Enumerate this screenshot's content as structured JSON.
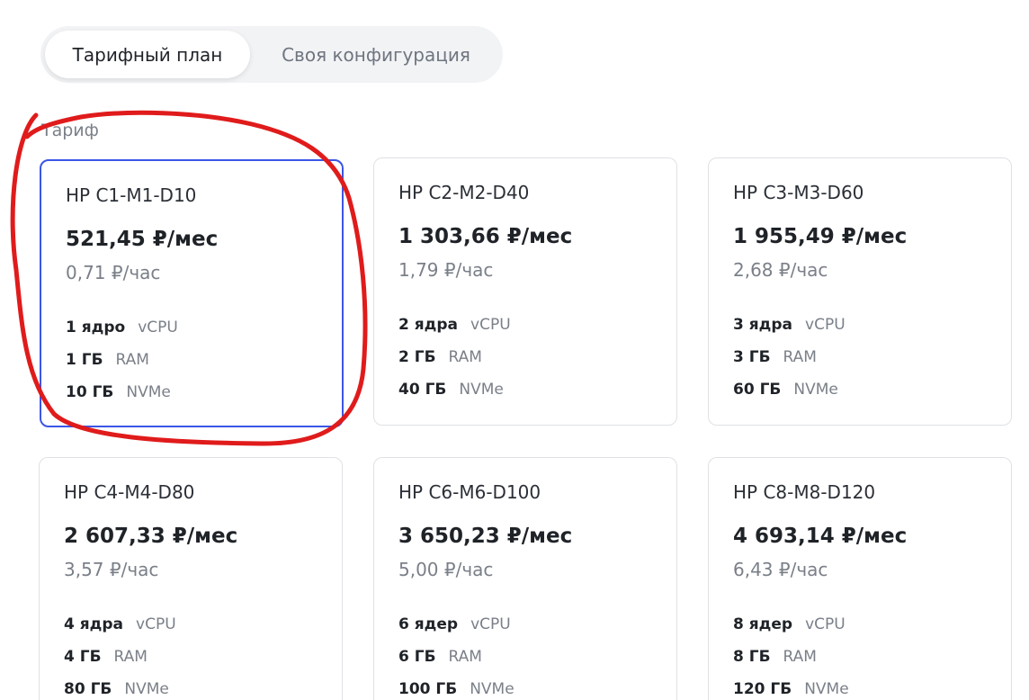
{
  "tabs": [
    {
      "label": "Тарифный план",
      "active": true
    },
    {
      "label": "Своя конфигурация",
      "active": false
    }
  ],
  "section_label": "Тариф",
  "colors": {
    "selected_border": "#3b56e6",
    "annotation": "#e01b1b"
  },
  "plans": [
    {
      "name": "HP C1-M1-D10",
      "price_month": "521,45 ₽/мес",
      "price_hour": "0,71 ₽/час",
      "cpu_value": "1 ядро",
      "cpu_unit": "vCPU",
      "ram_value": "1 ГБ",
      "ram_unit": "RAM",
      "disk_value": "10 ГБ",
      "disk_unit": "NVMe",
      "selected": true
    },
    {
      "name": "HP C2-M2-D40",
      "price_month": "1 303,66 ₽/мес",
      "price_hour": "1,79 ₽/час",
      "cpu_value": "2 ядра",
      "cpu_unit": "vCPU",
      "ram_value": "2 ГБ",
      "ram_unit": "RAM",
      "disk_value": "40 ГБ",
      "disk_unit": "NVMe",
      "selected": false
    },
    {
      "name": "HP C3-M3-D60",
      "price_month": "1 955,49 ₽/мес",
      "price_hour": "2,68 ₽/час",
      "cpu_value": "3 ядра",
      "cpu_unit": "vCPU",
      "ram_value": "3 ГБ",
      "ram_unit": "RAM",
      "disk_value": "60 ГБ",
      "disk_unit": "NVMe",
      "selected": false
    },
    {
      "name": "HP C4-M4-D80",
      "price_month": "2 607,33 ₽/мес",
      "price_hour": "3,57 ₽/час",
      "cpu_value": "4 ядра",
      "cpu_unit": "vCPU",
      "ram_value": "4 ГБ",
      "ram_unit": "RAM",
      "disk_value": "80 ГБ",
      "disk_unit": "NVMe",
      "selected": false
    },
    {
      "name": "HP C6-M6-D100",
      "price_month": "3 650,23 ₽/мес",
      "price_hour": "5,00 ₽/час",
      "cpu_value": "6 ядер",
      "cpu_unit": "vCPU",
      "ram_value": "6 ГБ",
      "ram_unit": "RAM",
      "disk_value": "100 ГБ",
      "disk_unit": "NVMe",
      "selected": false
    },
    {
      "name": "HP C8-M8-D120",
      "price_month": "4 693,14 ₽/мес",
      "price_hour": "6,43 ₽/час",
      "cpu_value": "8 ядер",
      "cpu_unit": "vCPU",
      "ram_value": "8 ГБ",
      "ram_unit": "RAM",
      "disk_value": "120 ГБ",
      "disk_unit": "NVMe",
      "selected": false
    }
  ]
}
